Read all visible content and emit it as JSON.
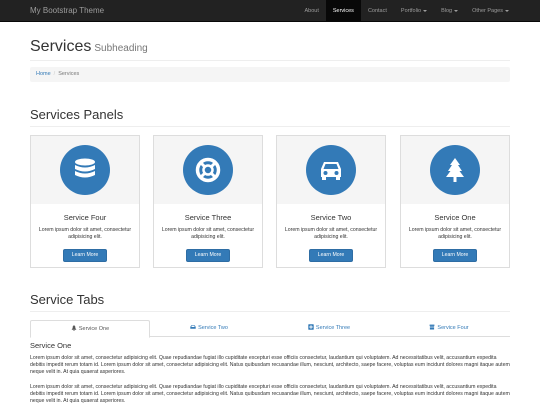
{
  "nav": {
    "brand": "My Bootstrap Theme",
    "items": [
      {
        "label": "About"
      },
      {
        "label": "Services"
      },
      {
        "label": "Contact"
      },
      {
        "label": "Portfolio"
      },
      {
        "label": "Blog"
      },
      {
        "label": "Other Pages"
      }
    ],
    "active": "Services"
  },
  "header": {
    "title": "Services",
    "subtitle": "Subheading"
  },
  "breadcrumb": {
    "home": "Home",
    "separator": "/",
    "current": "Services"
  },
  "panels_section": {
    "title": "Services Panels",
    "panels": [
      {
        "icon": "database-icon",
        "title": "Service Four",
        "text": "Lorem ipsum dolor sit amet, consectetur adipisicing elit.",
        "button": "Learn More"
      },
      {
        "icon": "life-ring-icon",
        "title": "Service Three",
        "text": "Lorem ipsum dolor sit amet, consectetur adipisicing elit.",
        "button": "Learn More"
      },
      {
        "icon": "car-icon",
        "title": "Service Two",
        "text": "Lorem ipsum dolor sit amet, consectetur adipisicing elit.",
        "button": "Learn More"
      },
      {
        "icon": "tree-icon",
        "title": "Service One",
        "text": "Lorem ipsum dolor sit amet, consectetur adipisicing elit.",
        "button": "Learn More"
      }
    ]
  },
  "tabs_section": {
    "title": "Service Tabs",
    "tabs": [
      {
        "label": "Service One",
        "icon": "tree-icon",
        "active": true
      },
      {
        "label": "Service Two",
        "icon": "car-icon",
        "active": false
      },
      {
        "label": "Service Three",
        "icon": "support-icon",
        "active": false
      },
      {
        "label": "Service Four",
        "icon": "database-icon",
        "active": false
      }
    ],
    "content_title": "Service One",
    "paragraphs": [
      "Lorem ipsum dolor sit amet, consectetur adipisicing elit. Quae repudiandae fugiat illo cupiditate excepturi esse officiis consectetur, laudantium qui voluptatem. Ad necessitatibus velit, accusantium expedita debitis impedit rerum totam id. Lorem ipsum dolor sit amet, consectetur adipisicing elit. Natus quibusdam recusandae illum, nesciunt, architecto, saepe facere, voluptas eum incidunt dolores magni itaque autem neque velit in. At quia quaerat asperiores.",
      "Lorem ipsum dolor sit amet, consectetur adipisicing elit. Quae repudiandae fugiat illo cupiditate excepturi esse officiis consectetur, laudantium qui voluptatem. Ad necessitatibus velit, accusantium expedita debitis impedit rerum totam id. Lorem ipsum dolor sit amet, consectetur adipisicing elit. Natus quibusdam recusandae illum, nesciunt, architecto, saepe facere, voluptas eum incidunt dolores magni itaque autem neque velit in. At quia quaerat asperiores."
    ]
  },
  "colors": {
    "primary": "#337ab7",
    "navbar": "#222222",
    "navbar_active": "#080808"
  }
}
